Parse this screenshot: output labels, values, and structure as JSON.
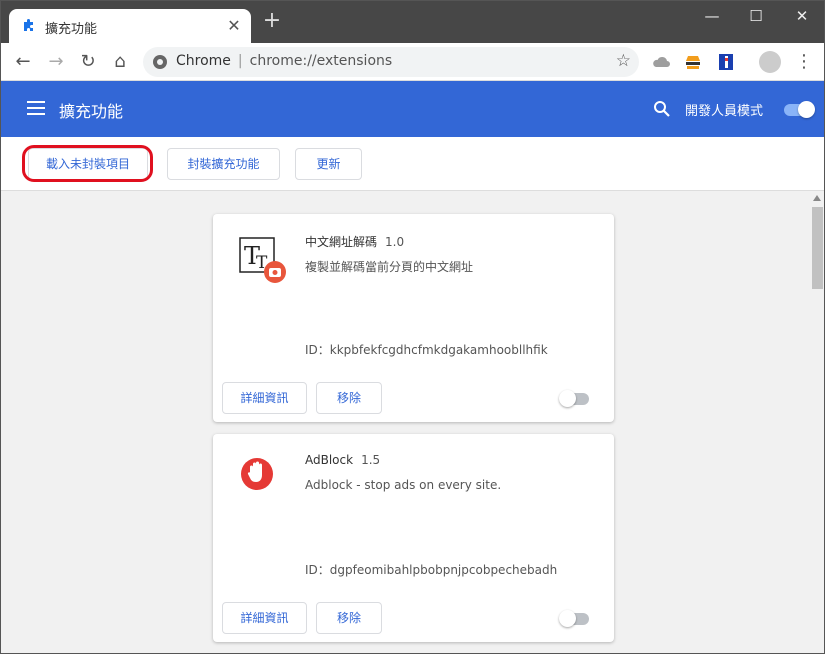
{
  "tab": {
    "title": "擴充功能",
    "close": "✕",
    "new_tab": "+"
  },
  "window_controls": {
    "minimize": "—",
    "maximize": "☐",
    "close": "✕"
  },
  "toolbar": {
    "back": "←",
    "forward": "→",
    "reload": "↻",
    "home": "⌂",
    "omnibox_site": "Chrome",
    "omnibox_separator": "|",
    "omnibox_url": "chrome://extensions",
    "star": "☆",
    "menu": "⋮"
  },
  "header": {
    "title": "擴充功能",
    "dev_mode_label": "開發人員模式",
    "dev_mode_on": true
  },
  "actions": {
    "load_unpacked": "載入未封裝項目",
    "pack_extension": "封裝擴充功能",
    "update": "更新"
  },
  "extensions": [
    {
      "name": "中文網址解碼",
      "version": "1.0",
      "description": "複製並解碼當前分頁的中文網址",
      "id_label": "ID：kkpbfekfcgdhcfmkdgakamhoobllhfik",
      "details_label": "詳細資訊",
      "remove_label": "移除",
      "enabled": false,
      "icon": "text-tt-icon"
    },
    {
      "name": "AdBlock",
      "version": "1.5",
      "description": "Adblock - stop ads on every site.",
      "id_label": "ID：dgpfeomibahlpbobpnjpcobpechebadh",
      "details_label": "詳細資訊",
      "remove_label": "移除",
      "enabled": false,
      "icon": "adblock-hand-icon"
    }
  ],
  "colors": {
    "header_blue": "#3367d6",
    "highlight_red": "#e0101f",
    "adblock_red": "#e53935"
  }
}
